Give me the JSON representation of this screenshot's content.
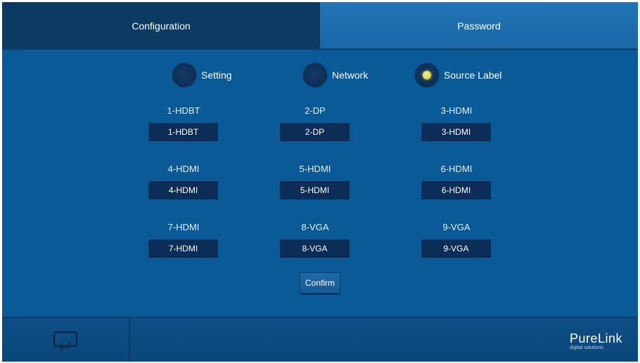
{
  "tabs": {
    "configuration": "Configuration",
    "password": "Password"
  },
  "modes": {
    "setting": "Setting",
    "network": "Network",
    "source_label": "Source Label",
    "selected": "source_label"
  },
  "sources": [
    {
      "caption": "1-HDBT",
      "value": "1-HDBT"
    },
    {
      "caption": "2-DP",
      "value": "2-DP"
    },
    {
      "caption": "3-HDMI",
      "value": "3-HDMI"
    },
    {
      "caption": "4-HDMI",
      "value": "4-HDMI"
    },
    {
      "caption": "5-HDMI",
      "value": "5-HDMI"
    },
    {
      "caption": "6-HDMI",
      "value": "6-HDMI"
    },
    {
      "caption": "7-HDMI",
      "value": "7-HDMI"
    },
    {
      "caption": "8-VGA",
      "value": "8-VGA"
    },
    {
      "caption": "9-VGA",
      "value": "9-VGA"
    }
  ],
  "confirm_label": "Confirm",
  "footer": {
    "back_icon": "return-icon",
    "logo_main": "PureLink",
    "logo_sub": "digital solutions"
  },
  "colors": {
    "background": "#0b5a98",
    "active_tab": "#0b3a62",
    "field": "#0b2d57",
    "selected_radio": "#e1d842"
  }
}
